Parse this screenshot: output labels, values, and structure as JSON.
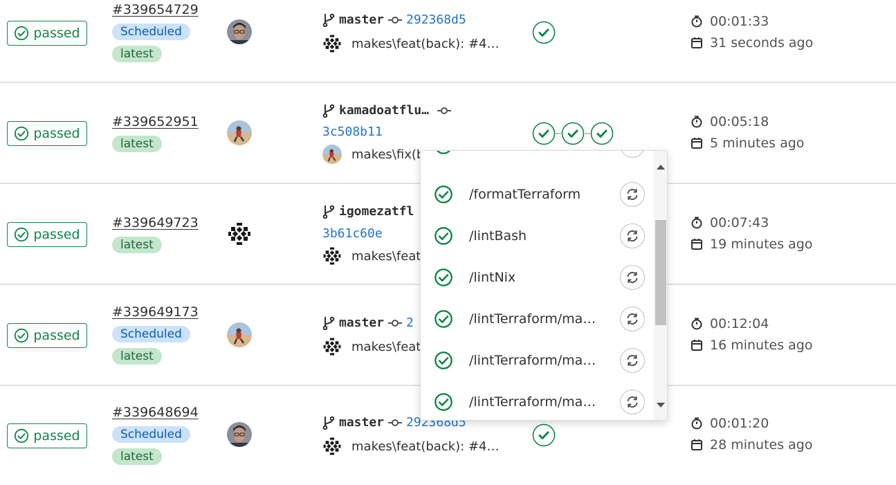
{
  "status_label": "passed",
  "pipelines": [
    {
      "id": "#339654729",
      "badges": [
        "Scheduled",
        "latest"
      ],
      "branch": "master",
      "sha": "292368d5",
      "commit_message": "makes\\feat(back): #4…",
      "stages": 1,
      "duration": "00:01:33",
      "finished": "31 seconds ago"
    },
    {
      "id": "#339652951",
      "badges": [
        "latest"
      ],
      "branch": "kamadoatflu…",
      "sha": "3c508b11",
      "commit_message": "makes\\fix(b",
      "stages": 3,
      "duration": "00:05:18",
      "finished": "5 minutes ago"
    },
    {
      "id": "#339649723",
      "badges": [
        "latest"
      ],
      "branch": "igomezatfl",
      "sha": "3b61c60e",
      "commit_message": "makes\\feat",
      "stages": 0,
      "duration": "00:07:43",
      "finished": "19 minutes ago"
    },
    {
      "id": "#339649173",
      "badges": [
        "Scheduled",
        "latest"
      ],
      "branch": "master",
      "sha": "2",
      "commit_message": "makes\\feat",
      "stages": 0,
      "duration": "00:12:04",
      "finished": "16 minutes ago"
    },
    {
      "id": "#339648694",
      "badges": [
        "Scheduled",
        "latest"
      ],
      "branch": "master",
      "sha": "292368d5",
      "commit_message": "makes\\feat(back): #4…",
      "stages": 1,
      "duration": "00:01:20",
      "finished": "28 minutes ago"
    }
  ],
  "dropdown": {
    "jobs": [
      "/formatTerraform",
      "/lintBash",
      "/lintNix",
      "/lintTerraform/ma…",
      "/lintTerraform/ma…",
      "/lintTerraform/ma…"
    ]
  },
  "icons": {
    "status": "check-circle-icon",
    "branch": "branch-icon",
    "commit": "commit-icon",
    "duration": "stopwatch-icon",
    "finished": "calendar-icon",
    "retry": "retry-icon"
  },
  "colors": {
    "success": "#108548",
    "link": "#1f75cb",
    "scheduled_bg": "#cbe2f9",
    "latest_bg": "#c3e6cd"
  }
}
